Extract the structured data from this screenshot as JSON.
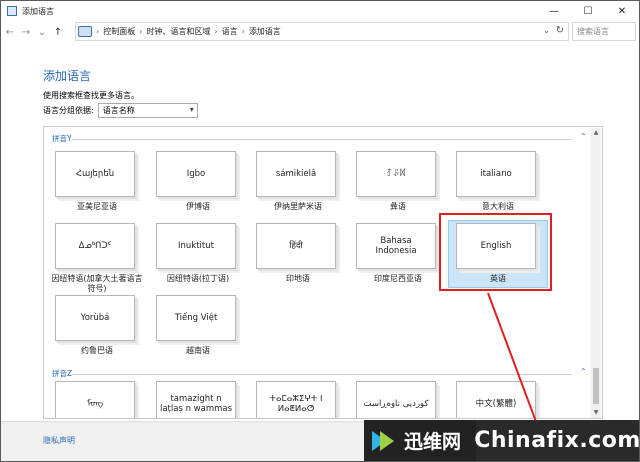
{
  "window": {
    "title": "添加语言",
    "controls": {
      "minimize": "—",
      "maximize": "☐",
      "close": "✕"
    }
  },
  "address": {
    "back": "←",
    "forward": "→",
    "recent": "⌄",
    "up": "↑",
    "crumbs": [
      "控制面板",
      "时钟、语言和区域",
      "语言",
      "添加语言"
    ],
    "separator": "›",
    "dropdown": "⌄",
    "refresh": "↻",
    "search_placeholder": "搜索语言"
  },
  "page": {
    "heading": "添加语言",
    "instruction": "使用搜索框查找更多语言。",
    "group_by_label": "语言分组依据:",
    "group_by_value": "语言名称"
  },
  "groups": [
    {
      "name": "拼音Y",
      "collapse": "⌃",
      "languages": [
        {
          "card": "Հայերեն",
          "label": "亚美尼亚语",
          "selected": false
        },
        {
          "card": "Igbo",
          "label": "伊博语",
          "selected": false
        },
        {
          "card": "sámikielâ",
          "label": "伊纳里萨米语",
          "selected": false
        },
        {
          "card": "ꆈꌠꉙ",
          "label": "彝语",
          "selected": false
        },
        {
          "card": "italiano",
          "label": "意大利语",
          "selected": false
        },
        {
          "card": "ᐃᓄᒃᑎᑐᑦ",
          "label": "因纽特语(加拿大土著语言符号)",
          "selected": false
        },
        {
          "card": "Inuktitut",
          "label": "因纽特语(拉丁语)",
          "selected": false
        },
        {
          "card": "हिंदी",
          "label": "印地语",
          "selected": false
        },
        {
          "card": "Bahasa Indonesia",
          "label": "印度尼西亚语",
          "selected": false
        },
        {
          "card": "English",
          "label": "英语",
          "selected": true
        },
        {
          "card": "Yorùbá",
          "label": "约鲁巴语",
          "selected": false
        },
        {
          "card": "Tiếng Việt",
          "label": "越南语",
          "selected": false
        }
      ]
    },
    {
      "name": "拼音Z",
      "collapse": "⌃",
      "languages": [
        {
          "card": "ᠮᠣᠩ",
          "label": ""
        },
        {
          "card": "tamazight n laṭlaṣ n wammas",
          "label": ""
        },
        {
          "card": "ⵜⴰⵎⴰⵣⵉⵖⵜ ⵏ ⵍⴰⵟⵍⴰⵚ",
          "label": ""
        },
        {
          "card": "کوردیی ناوەڕاست",
          "label": ""
        },
        {
          "card": "中文(繁體)",
          "label": ""
        }
      ]
    }
  ],
  "scrollbar": {
    "up": "▲",
    "down": "▼"
  },
  "footer": {
    "privacy_link": "隐私声明"
  },
  "watermark": {
    "brand_cn": "迅维网",
    "site": "Chinafix.com"
  },
  "colors": {
    "link_blue": "#2667b5",
    "selection_bg": "#cce4f7",
    "highlight_red": "#e02020"
  }
}
